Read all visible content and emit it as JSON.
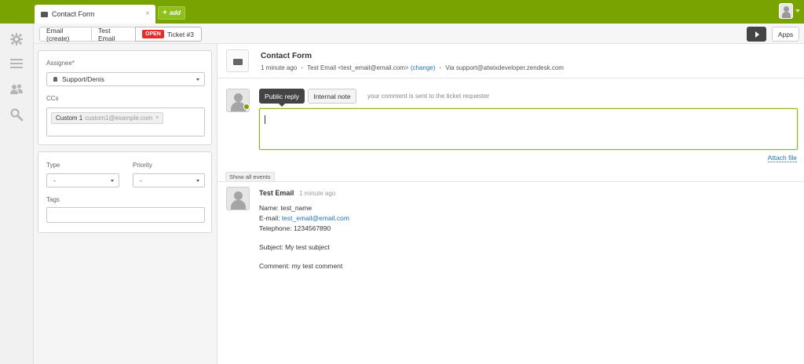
{
  "topbar": {
    "tab_title": "Contact Form",
    "tab_close": "×",
    "add_label": "add",
    "add_plus": "+"
  },
  "toolbar": {
    "crumbs": [
      "Email (create)",
      "Test Email"
    ],
    "status_badge": "OPEN",
    "ticket_label": "Ticket #3",
    "apps_label": "Apps"
  },
  "properties": {
    "assignee_label": "Assignee*",
    "assignee_value": "Support/Denis",
    "ccs_label": "CCs",
    "cc_name": "Custom 1",
    "cc_email": "custom1@example.com",
    "cc_remove": "×",
    "type_label": "Type",
    "type_value": "-",
    "priority_label": "Priority",
    "priority_value": "-",
    "tags_label": "Tags"
  },
  "conversation": {
    "title": "Contact Form",
    "time": "1 minute ago",
    "requester": "Test Email <test_email@email.com>",
    "change_link": "(change)",
    "via": "Via support@atwixdeveloper.zendesk.com",
    "sep": "•"
  },
  "reply": {
    "public_label": "Public reply",
    "internal_label": "Internal note",
    "hint": "your comment is sent to the ticket requester",
    "attach_label": "Attach file",
    "show_events": "Show all events"
  },
  "event": {
    "author": "Test Email",
    "time": "1 minute ago",
    "name_line": "Name: test_name",
    "email_prefix": "E-mail: ",
    "email_value": "test_email@email.com",
    "phone_line": "Telephone: 1234567890",
    "subject_line": "Subject: My test subject",
    "comment_line": "Comment: my test comment"
  },
  "colors": {
    "brand": "#78a300",
    "open_badge": "#e82a2a",
    "link": "#1f73b7"
  },
  "icons": {
    "nav": [
      "gear-icon",
      "list-icon",
      "users-icon",
      "search-icon"
    ]
  }
}
